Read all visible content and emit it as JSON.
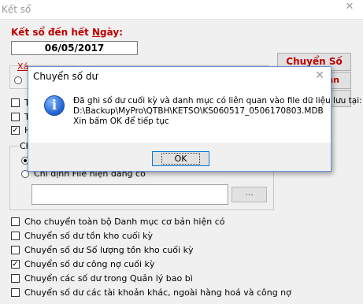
{
  "window": {
    "title": "Kết sổ"
  },
  "form": {
    "date_label_pre": "Kết sổ đến hết ",
    "date_label_accel": "N",
    "date_label_post": "gày:",
    "date_value": "06/05/2017",
    "transfer_button": "Chuyển Số dư",
    "partial_right_button": "ân",
    "partial_left_text_1": "Xá",
    "partial_left_text_2": "T",
    "partial_left_text_3": "T",
    "partial_left_text_4": "H",
    "partial_group_label": "Ch",
    "file_option_label": "Chỉ định File hiện đang có",
    "browse_button": "...",
    "options": [
      {
        "label": "Cho chuyển toàn bộ Danh mục cơ bản hiện có",
        "checked": false
      },
      {
        "label": "Chuyển số dư tồn kho cuối kỳ",
        "checked": false
      },
      {
        "label": "Chuyển số dư Số lượng tồn kho cuối kỳ",
        "checked": false
      },
      {
        "label": "Chuyển số dư công nợ cuối kỳ",
        "checked": true
      },
      {
        "label": "Chuyển các số dư trong Quản lý bao bì",
        "checked": false
      },
      {
        "label": "Chuyển số dư các tài khoản khác, ngoài hàng hoá và công nợ",
        "checked": false
      }
    ]
  },
  "dialog": {
    "title": "Chuyển số dư",
    "line1": "Đã ghi số dư cuối kỳ và danh mục có liên quan vào file dữ liệu lưu tại:",
    "line2": "D:\\Backup\\MyPro\\QTBH\\KETSO\\KS060517_0506170803.MDB",
    "line3": "Xin bấm OK để tiếp tục",
    "ok_button": "OK",
    "icon": "information-icon"
  }
}
